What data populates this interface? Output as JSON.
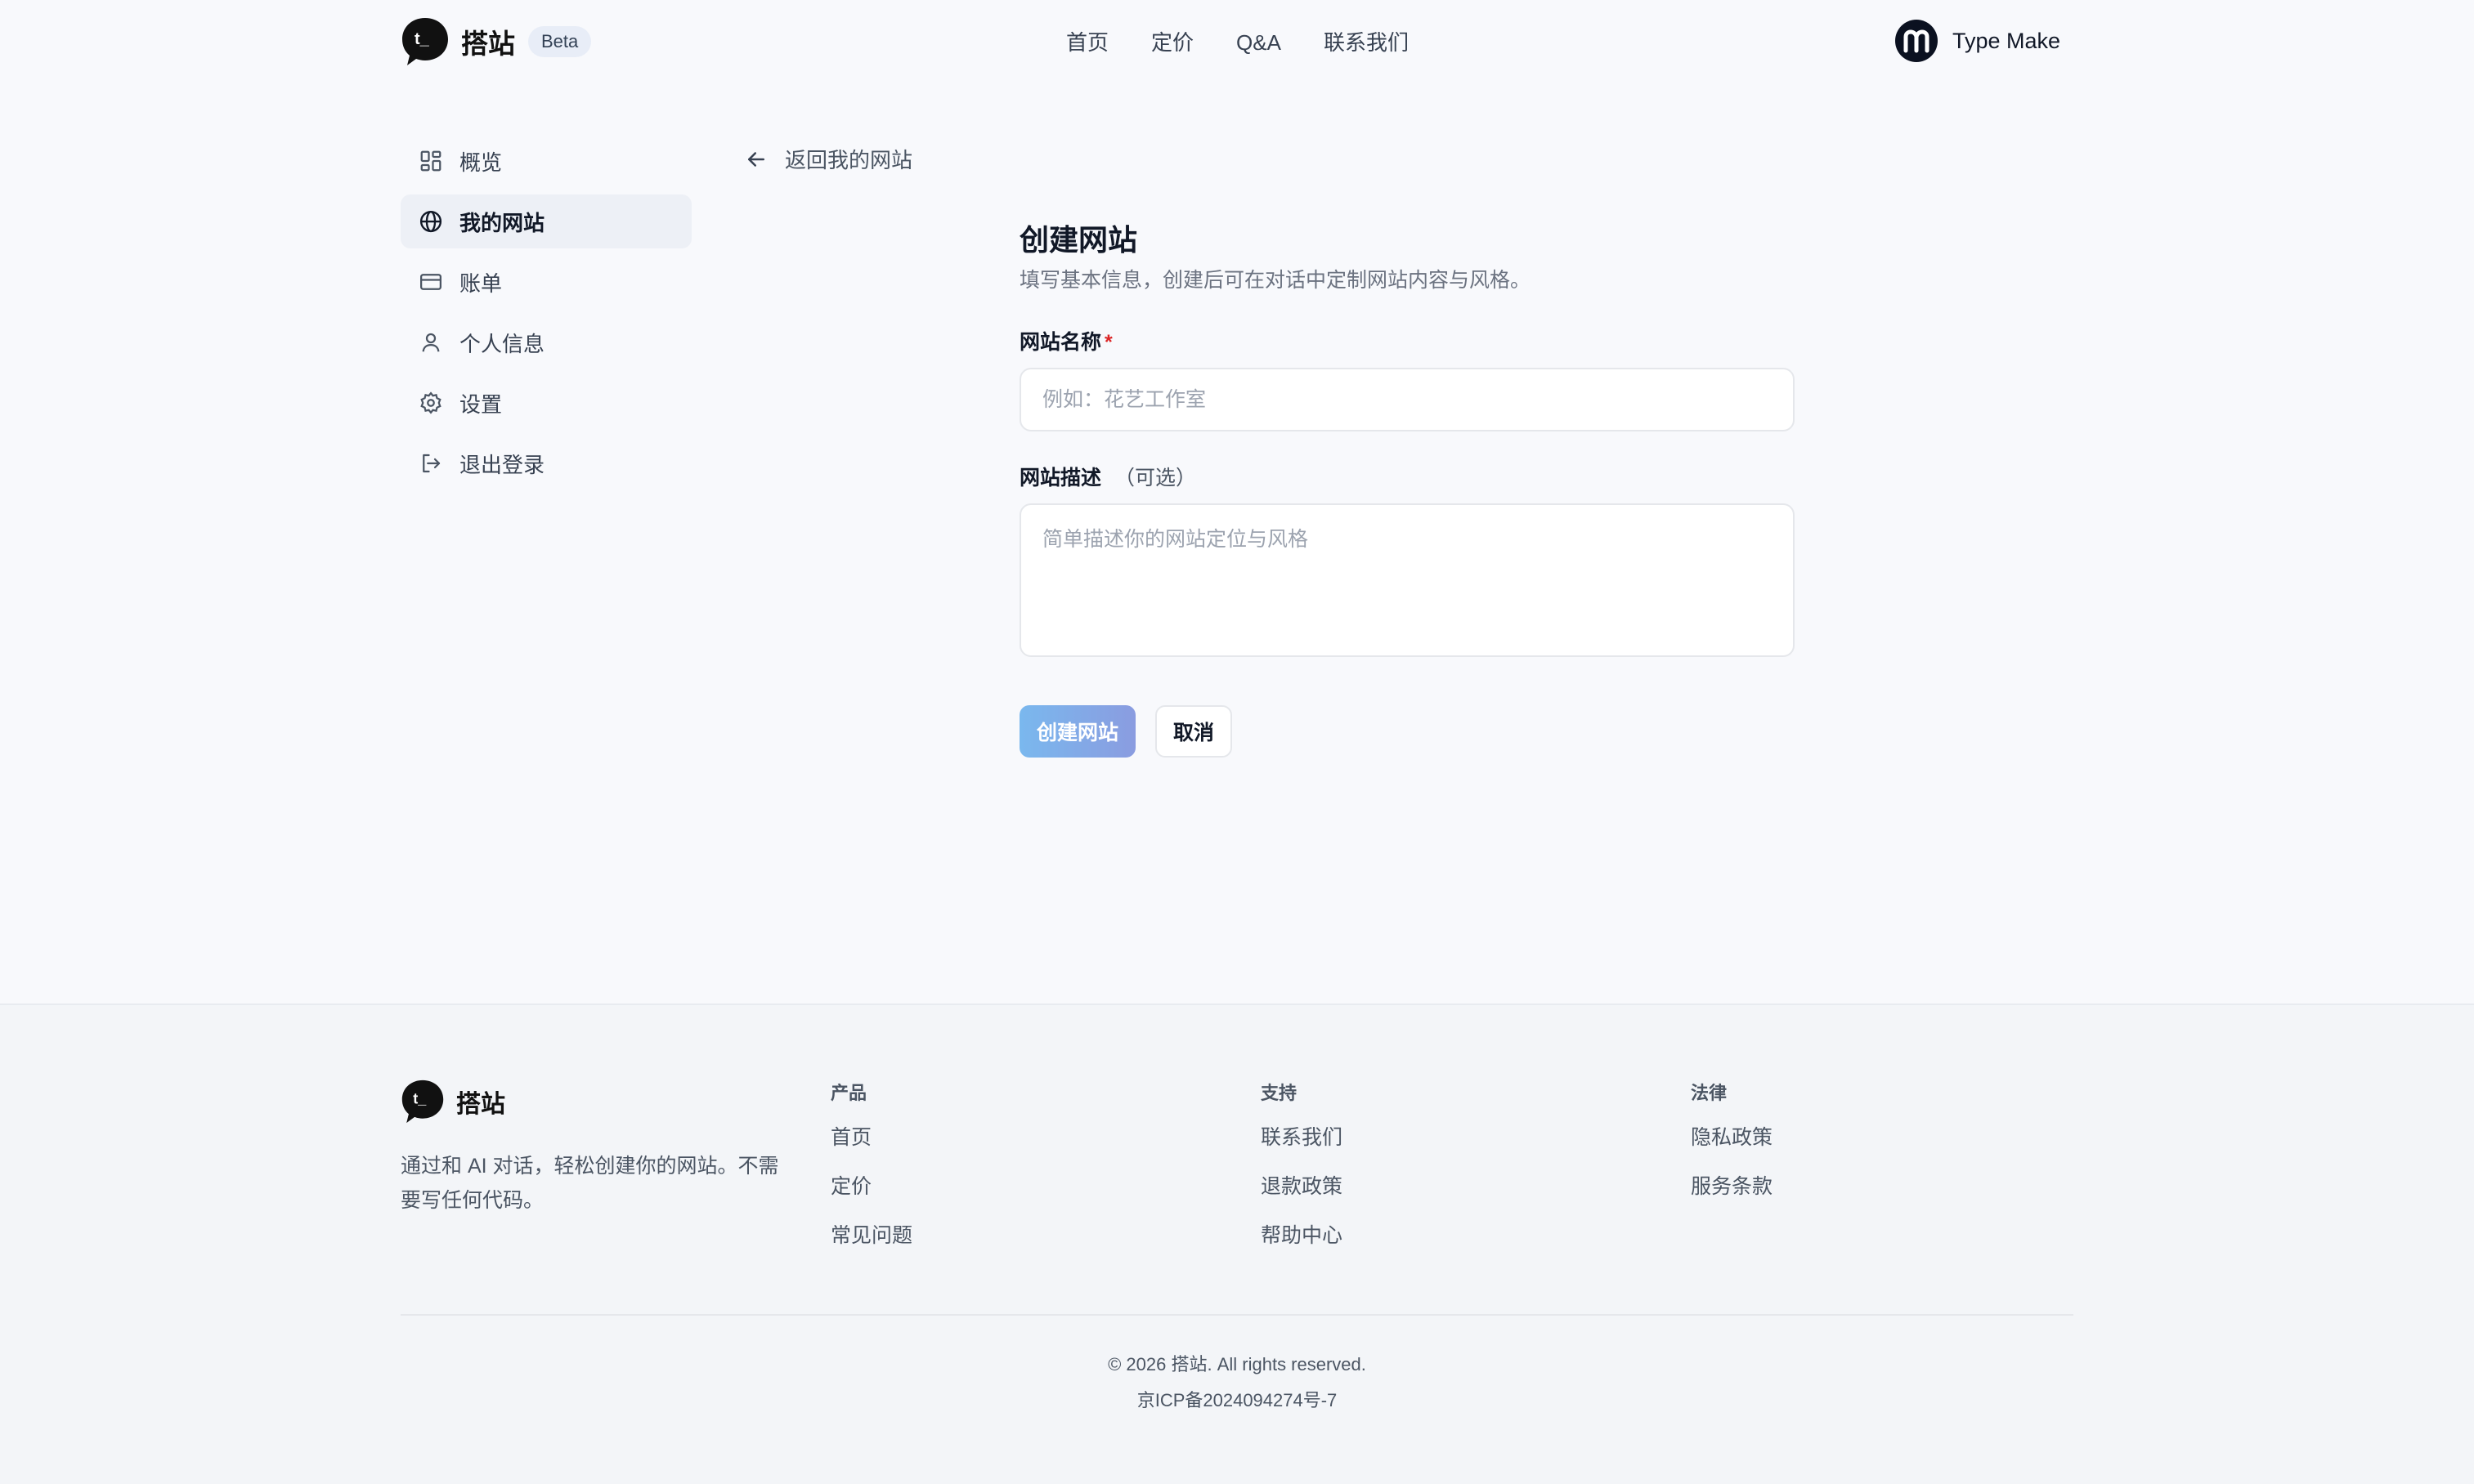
{
  "brand": {
    "name": "搭站",
    "badge": "Beta",
    "logo_glyph": "t_"
  },
  "nav": {
    "items": [
      "首页",
      "定价",
      "Q&A",
      "联系我们"
    ]
  },
  "user": {
    "name": "Type Make",
    "avatar_glyph": "m"
  },
  "sidebar": {
    "items": [
      {
        "label": "概览",
        "icon": "grid-icon"
      },
      {
        "label": "我的网站",
        "icon": "globe-icon",
        "active": true
      },
      {
        "label": "账单",
        "icon": "credit-card-icon"
      },
      {
        "label": "个人信息",
        "icon": "user-icon"
      },
      {
        "label": "设置",
        "icon": "gear-icon"
      },
      {
        "label": "退出登录",
        "icon": "logout-icon"
      }
    ]
  },
  "back_link": {
    "label": "返回我的网站",
    "icon": "arrow-left-icon"
  },
  "form": {
    "title": "创建网站",
    "subtitle": "填写基本信息，创建后可在对话中定制网站内容与风格。",
    "name_field": {
      "label": "网站名称",
      "required_mark": "*",
      "placeholder": "例如：花艺工作室",
      "value": ""
    },
    "desc_field": {
      "label": "网站描述",
      "optional_note": "（可选）",
      "placeholder": "简单描述你的网站定位与风格",
      "value": ""
    },
    "submit_label": "创建网站",
    "cancel_label": "取消"
  },
  "footer": {
    "brand_name": "搭站",
    "tagline": "通过和 AI 对话，轻松创建你的网站。不需要写任何代码。",
    "columns": [
      {
        "heading": "产品",
        "links": [
          "首页",
          "定价",
          "常见问题"
        ]
      },
      {
        "heading": "支持",
        "links": [
          "联系我们",
          "退款政策",
          "帮助中心"
        ]
      },
      {
        "heading": "法律",
        "links": [
          "隐私政策",
          "服务条款"
        ]
      }
    ],
    "copyright": "© 2026 搭站. All rights reserved.",
    "icp": "京ICP备2024094274号-7"
  },
  "colors": {
    "background": "#f8f9fc",
    "footer_background": "#f3f5f8",
    "sidebar_active": "#edf0f6",
    "primary_gradient_start": "#7ab8ee",
    "primary_gradient_end": "#8a9ce0",
    "required": "#dc2626"
  }
}
